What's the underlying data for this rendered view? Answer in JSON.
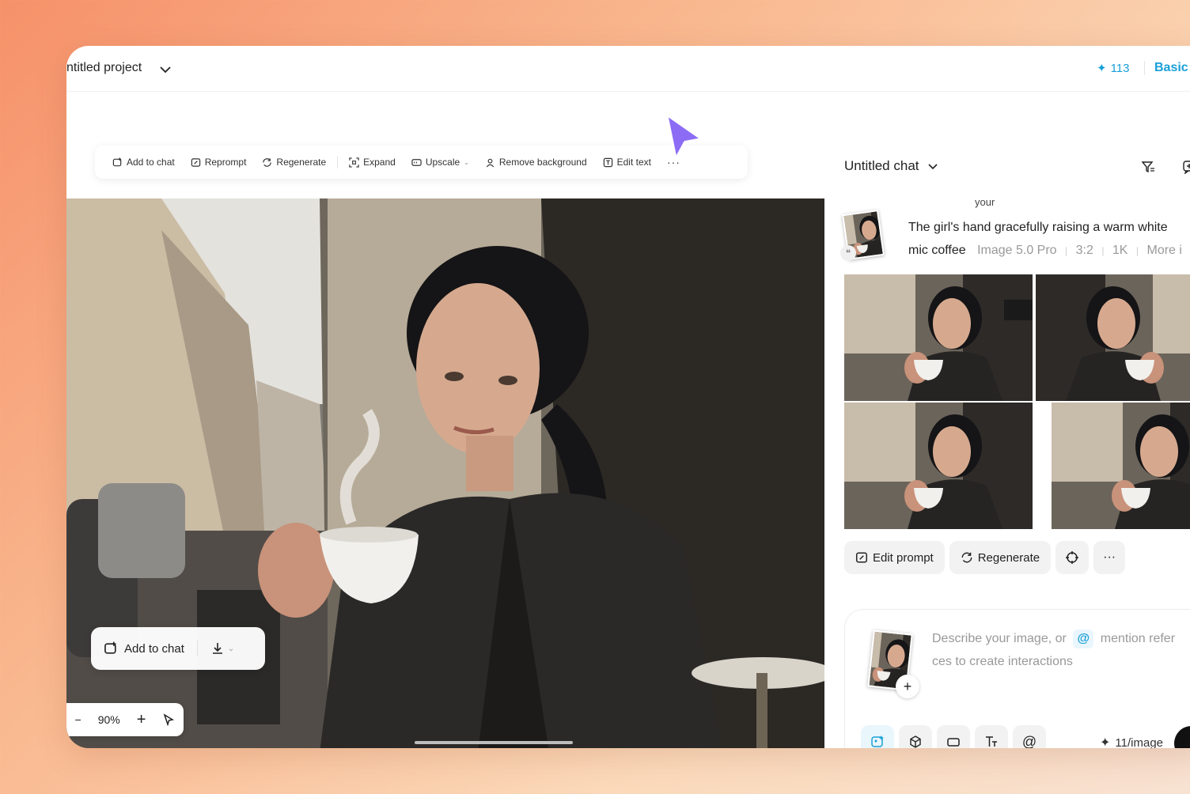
{
  "header": {
    "project_title": "ntitled project",
    "credits": "113",
    "plan": "Basic"
  },
  "toolbar": {
    "add_to_chat": "Add to chat",
    "reprompt": "Reprompt",
    "regenerate": "Regenerate",
    "expand": "Expand",
    "upscale": "Upscale",
    "remove_background": "Remove background",
    "edit_text": "Edit text"
  },
  "canvas": {
    "add_to_chat": "Add to chat",
    "zoom": "90%"
  },
  "chat": {
    "title": "Untitled chat",
    "your_label": "your",
    "prompt_line1": "The girl's hand gracefully raising a warm white",
    "prompt_line2_start": "mic coffee",
    "model": "Image 5.0 Pro",
    "ratio": "3:2",
    "resolution": "1K",
    "more": "More i",
    "actions": {
      "edit_prompt": "Edit prompt",
      "regenerate": "Regenerate"
    }
  },
  "composer": {
    "placeholder_part1": "Describe your image, or",
    "placeholder_at": "@",
    "placeholder_part2": "mention refer",
    "placeholder_line2": "ces to create interactions",
    "rate": "11/image"
  },
  "colors": {
    "accent": "#1aa0d8",
    "cursor": "#8c6cf5"
  }
}
